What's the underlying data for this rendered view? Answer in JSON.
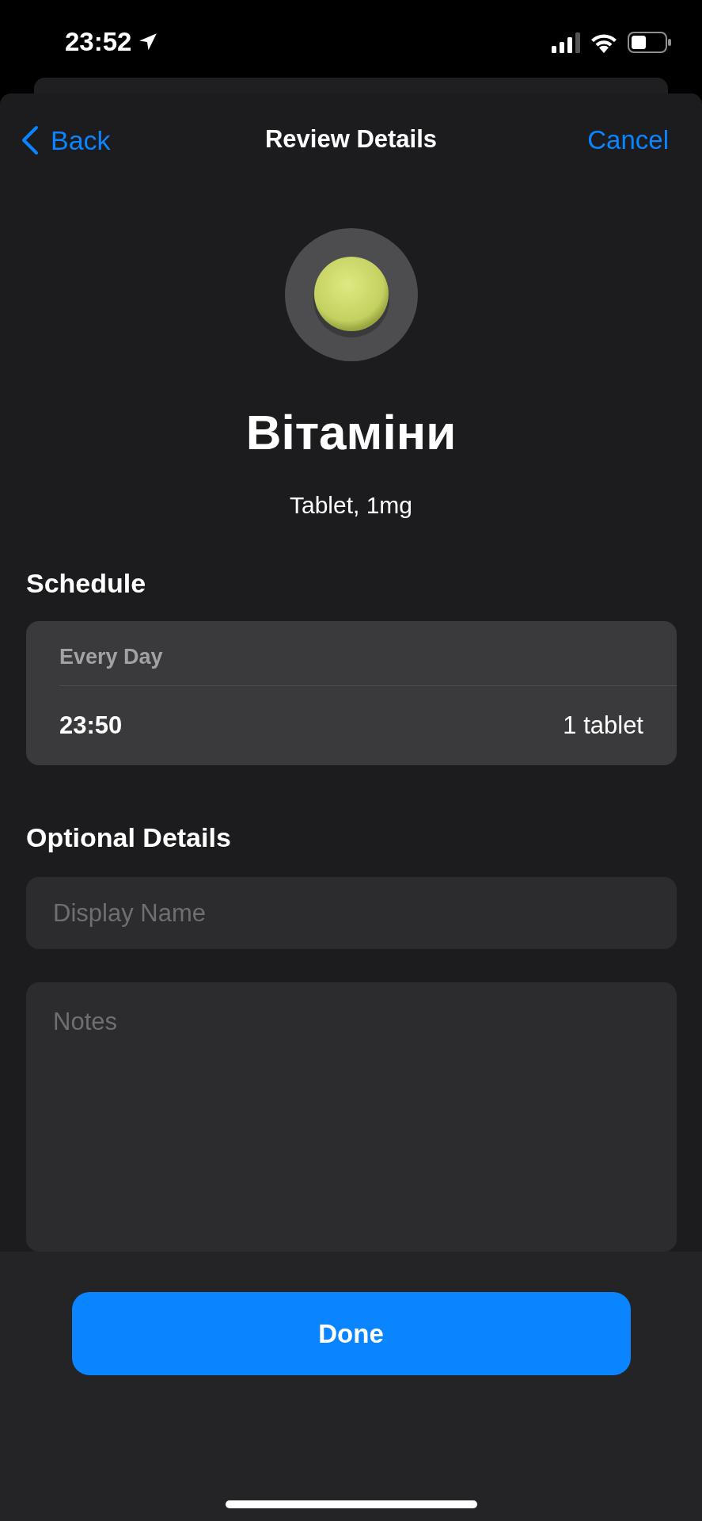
{
  "status_bar": {
    "time": "23:52"
  },
  "nav": {
    "back": "Back",
    "title": "Review Details",
    "cancel": "Cancel"
  },
  "medication": {
    "name": "Вітаміни",
    "description": "Tablet, 1mg"
  },
  "schedule": {
    "heading": "Schedule",
    "frequency": "Every Day",
    "rows": [
      {
        "time": "23:50",
        "dose": "1 tablet"
      }
    ]
  },
  "optional_details": {
    "heading": "Optional Details",
    "display_name": {
      "placeholder": "Display Name"
    },
    "notes": {
      "placeholder": "Notes"
    }
  },
  "done_button": "Done"
}
